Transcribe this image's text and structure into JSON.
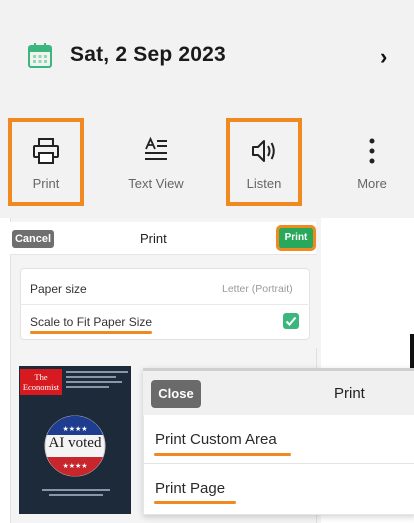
{
  "date_bar": {
    "date": "Sat, 2 Sep 2023",
    "calendar_icon": "calendar-icon",
    "chevron_icon": "chevron-right-icon"
  },
  "toolbar": {
    "items": [
      {
        "label": "Print",
        "icon": "printer-icon",
        "highlighted": true
      },
      {
        "label": "Text View",
        "icon": "text-view-icon",
        "highlighted": false
      },
      {
        "label": "Listen",
        "icon": "speaker-icon",
        "highlighted": true
      },
      {
        "label": "More",
        "icon": "more-vertical-icon",
        "highlighted": false
      }
    ]
  },
  "print_sheet": {
    "cancel_label": "Cancel",
    "title": "Print",
    "print_label": "Print",
    "paper_size_label": "Paper size",
    "paper_size_value": "Letter (Portrait)",
    "scale_label": "Scale to Fit Paper Size",
    "scale_checked": true
  },
  "cover": {
    "logo": "The Economist",
    "headline": "AI voted"
  },
  "print_popup": {
    "close_label": "Close",
    "title": "Print",
    "options": [
      "Print Custom Area",
      "Print Page"
    ]
  },
  "colors": {
    "highlight": "#f0891f",
    "accent_green": "#27a85a",
    "calendar_green": "#3bb77e"
  }
}
